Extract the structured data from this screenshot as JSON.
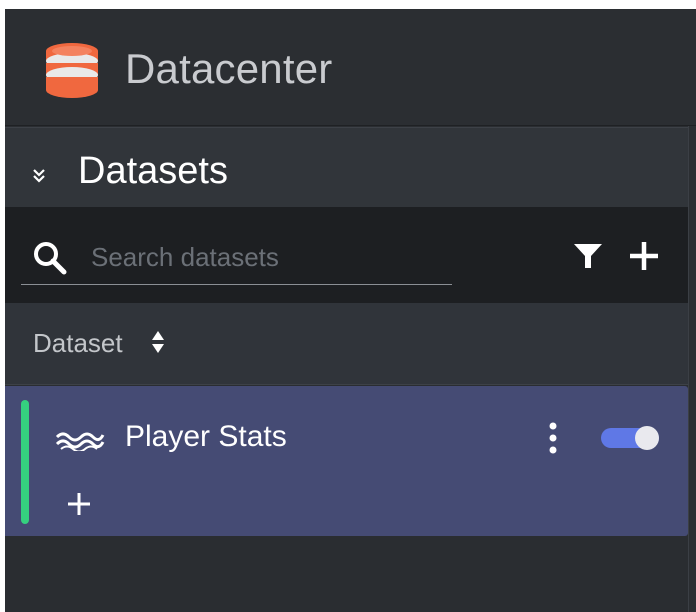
{
  "app": {
    "title": "Datacenter",
    "icon": "database-icon",
    "icon_colors": [
      "#f0683f",
      "#e9e9e9"
    ]
  },
  "section": {
    "title": "Datasets",
    "collapse_icon": "double-chevron-down-icon"
  },
  "toolbar": {
    "search_placeholder": "Search datasets",
    "search_value": "",
    "search_icon": "search-icon",
    "filter_icon": "filter-icon",
    "add_icon": "plus-icon"
  },
  "table": {
    "column_header": "Dataset",
    "sort_icon": "sort-icon"
  },
  "datasets": [
    {
      "name": "Player Stats",
      "icon": "wave-icon",
      "status_color": "#35d07f",
      "row_color": "#454b74",
      "enabled": true,
      "toggle_color": "#5f78e6",
      "menu_icon": "kebab-menu-icon",
      "add_icon": "plus-icon"
    }
  ]
}
